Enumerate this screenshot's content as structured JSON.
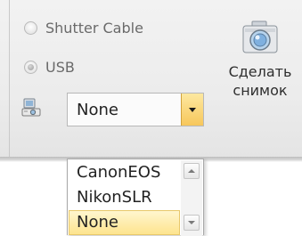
{
  "source": {
    "options": [
      {
        "label": "Shutter Cable",
        "checked": false
      },
      {
        "label": "USB",
        "checked": true
      }
    ],
    "device_icon": "camera-device-icon"
  },
  "combo": {
    "value": "None",
    "button_icon": "dropdown-arrow-icon"
  },
  "capture": {
    "label_line1": "Сделать",
    "label_line2": "снимок",
    "icon": "camera-icon"
  },
  "dropdown": {
    "options": [
      "CanonEOS",
      "NikonSLR",
      "None"
    ],
    "selected": "None",
    "scroll_up_icon": "scroll-up-arrow-icon",
    "scroll_down_icon": "scroll-down-arrow-icon"
  },
  "colors": {
    "accent": "#f7c75b",
    "selection": "#fde48e"
  }
}
